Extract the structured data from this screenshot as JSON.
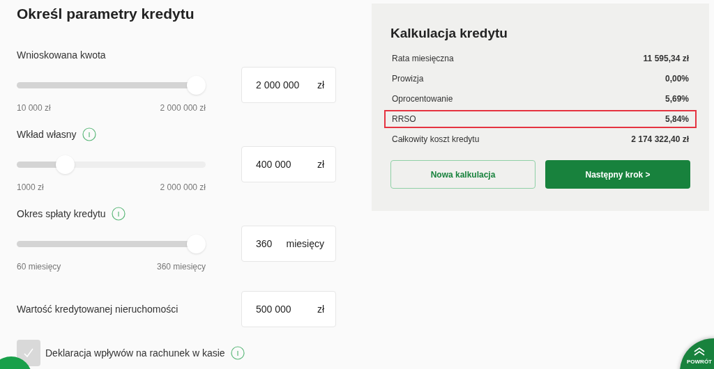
{
  "form": {
    "title": "Określ parametry kredytu",
    "fields": [
      {
        "kind": "slider",
        "label": "Wnioskowana kwota",
        "info": false,
        "level": 1,
        "min": "10 000 zł",
        "max": "2 000 000 zł",
        "value": "2 000 000",
        "unit": "zł"
      },
      {
        "kind": "slider",
        "label": "Wkład własny",
        "info": true,
        "level": 0.23,
        "min": "1000 zł",
        "max": "2 000 000 zł",
        "value": "400 000",
        "unit": "zł"
      },
      {
        "kind": "slider",
        "label": "Okres spłaty kredytu",
        "info": true,
        "level": 1,
        "min": "60 miesięcy",
        "max": "360 miesięcy",
        "value": "360",
        "unit": "miesięcy"
      },
      {
        "kind": "input",
        "label": "Wartość kredytowanej nieruchomości",
        "info": false,
        "value": "500 000",
        "unit": "zł"
      }
    ],
    "checkbox": {
      "label": "Deklaracja wpływów na rachunek w kasie",
      "checked": true,
      "info": true
    }
  },
  "summary": {
    "title": "Kalkulacja kredytu",
    "rows": [
      {
        "label": "Rata miesięczna",
        "value": "11 595,34 zł",
        "highlighted": false
      },
      {
        "label": "Prowizja",
        "value": "0,00%",
        "highlighted": false
      },
      {
        "label": "Oprocentowanie",
        "value": "5,69%",
        "highlighted": false
      },
      {
        "label": "RRSO",
        "value": "5,84%",
        "highlighted": true
      },
      {
        "label": "Całkowity koszt kredytu",
        "value": "2 174 322,40 zł",
        "highlighted": false
      }
    ],
    "buttons": [
      {
        "kind": "secondary",
        "label": "Nowa kalkulacja"
      },
      {
        "kind": "primary",
        "label": "Następny krok >"
      }
    ]
  },
  "back_to_top": {
    "label": "POWRÓT"
  }
}
